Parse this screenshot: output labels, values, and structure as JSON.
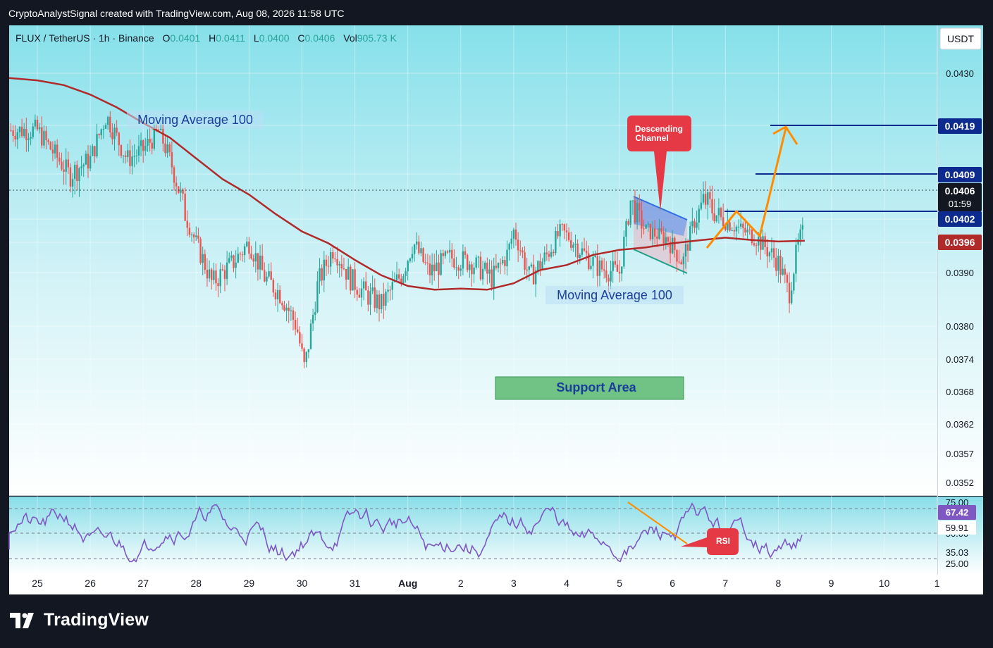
{
  "header": {
    "created_by": "CryptoAnalystSignal created with TradingView.com, Aug 08, 2026 11:58 UTC"
  },
  "symbol_bar": {
    "symbol": "FLUX / TetherUS · 1h · Binance",
    "o_label": "O",
    "o_value": "0.0401",
    "h_label": "H",
    "h_value": "0.0411",
    "l_label": "L",
    "l_value": "0.0400",
    "c_label": "C",
    "c_value": "0.0406",
    "vol_label": "Vol",
    "vol_value": "905.73 K"
  },
  "currency_button": "USDT",
  "brand": {
    "name": "TradingView"
  },
  "colors": {
    "up": "#26a69a",
    "down": "#ef5350",
    "ma": "#b02a2a",
    "blue_line": "#0d2b8e",
    "orange": "#ff8c00",
    "rsi": "#7e57c2",
    "callout": "#e53945",
    "support": "#52b06a"
  },
  "annotations": {
    "ma_label_1": "Moving Average 100",
    "ma_label_2": "Moving Average 100",
    "channel_label_1": "Descending",
    "channel_label_2": "Channel",
    "support_label": "Support Area",
    "rsi_label": "RSI"
  },
  "chart_data": {
    "type": "candlestick",
    "symbol": "FLUX/USDT",
    "interval": "1h",
    "price_axis": {
      "ticks": [
        "0.0430",
        "0.0419",
        "0.0409",
        "0.0402",
        "0.0396",
        "0.0390",
        "0.0380",
        "0.0374",
        "0.0368",
        "0.0362",
        "0.0357",
        "0.0352"
      ],
      "last_price": "0.0406",
      "countdown": "01:59",
      "tags": [
        {
          "value": "0.0419",
          "style": "blue"
        },
        {
          "value": "0.0409",
          "style": "blue"
        },
        {
          "value": "0.0402",
          "style": "blue"
        },
        {
          "value": "0.0396",
          "style": "ma"
        }
      ]
    },
    "time_axis": [
      "25",
      "26",
      "27",
      "28",
      "29",
      "30",
      "31",
      "Aug",
      "2",
      "3",
      "4",
      "5",
      "6",
      "7",
      "8",
      "9",
      "10",
      "1"
    ],
    "ma_100": [
      [
        "Jul 25 00:00",
        0.04285
      ],
      [
        "Jul 25 12:00",
        0.04275
      ],
      [
        "Jul 26 00:00",
        0.04255
      ],
      [
        "Jul 26 12:00",
        0.04228
      ],
      [
        "Jul 27 00:00",
        0.04195
      ],
      [
        "Jul 27 12:00",
        0.04165
      ],
      [
        "Jul 28 00:00",
        0.04122
      ],
      [
        "Jul 28 12:00",
        0.04082
      ],
      [
        "Jul 29 00:00",
        0.04058
      ],
      [
        "Jul 29 12:00",
        0.04028
      ],
      [
        "Jul 30 00:00",
        0.03988
      ],
      [
        "Jul 30 12:00",
        0.03958
      ],
      [
        "Jul 31 00:00",
        0.03925
      ],
      [
        "Jul 31 12:00",
        0.03895
      ],
      [
        "Aug 1 00:00",
        0.03875
      ],
      [
        "Aug 1 12:00",
        0.03868
      ],
      [
        "Aug 2 00:00",
        0.0387
      ],
      [
        "Aug 2 12:00",
        0.03868
      ],
      [
        "Aug 3 00:00",
        0.0388
      ],
      [
        "Aug 3 12:00",
        0.03905
      ],
      [
        "Aug 4 00:00",
        0.03915
      ],
      [
        "Aug 4 12:00",
        0.03935
      ],
      [
        "Aug 5 00:00",
        0.03945
      ],
      [
        "Aug 5 12:00",
        0.0395
      ],
      [
        "Aug 6 00:00",
        0.03958
      ],
      [
        "Aug 6 12:00",
        0.03965
      ],
      [
        "Aug 7 00:00",
        0.03972
      ],
      [
        "Aug 7 12:00",
        0.03966
      ],
      [
        "Aug 8 00:00",
        0.03962
      ],
      [
        "Aug 8 12:00",
        0.03964
      ]
    ],
    "horizontal_levels": [
      0.0419,
      0.0409,
      0.0402
    ],
    "support_zone": [
      0.03665,
      0.03715
    ],
    "rsi": {
      "levels": [
        "75.00",
        "59.91",
        "35.03",
        "25.00"
      ],
      "current": "67.42",
      "mid_label": "50.00"
    }
  }
}
